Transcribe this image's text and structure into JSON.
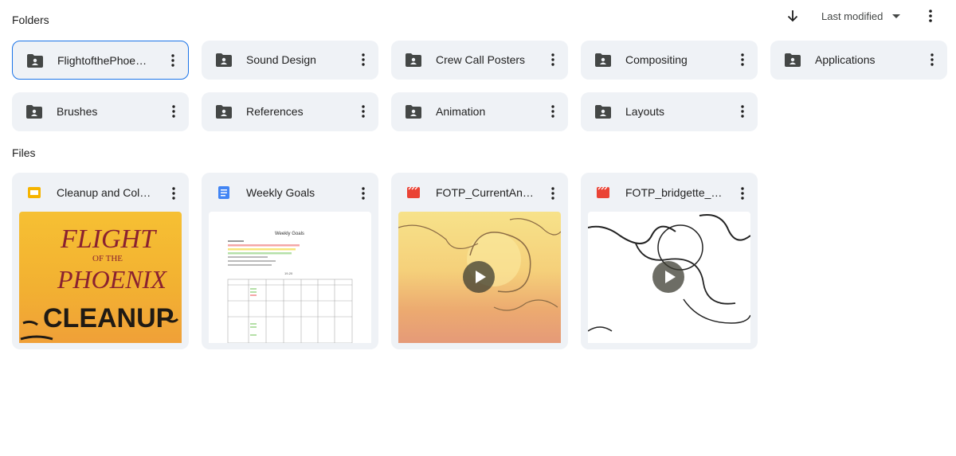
{
  "sections": {
    "folders_title": "Folders",
    "files_title": "Files"
  },
  "toolbar": {
    "sort_label": "Last modified",
    "icons": [
      "arrow-down-icon",
      "caret-down-icon",
      "more-vert-icon"
    ]
  },
  "folders": [
    {
      "name": "FlightofthePhoe…",
      "selected": true
    },
    {
      "name": "Sound Design"
    },
    {
      "name": "Crew Call Posters"
    },
    {
      "name": "Compositing"
    },
    {
      "name": "Applications"
    },
    {
      "name": "Brushes"
    },
    {
      "name": "References"
    },
    {
      "name": "Animation"
    },
    {
      "name": "Layouts"
    }
  ],
  "files": [
    {
      "name": "Cleanup and Col…",
      "type": "slides",
      "icon": "slides-icon",
      "icon_color": "#f6b400",
      "thumb": {
        "line1": "FLIGHT",
        "line2": "OF THE",
        "line3": "PHOENIX",
        "line4": "CLEANUP"
      }
    },
    {
      "name": "Weekly Goals",
      "type": "doc",
      "icon": "docs-icon",
      "icon_color": "#4285f4",
      "thumb": {
        "heading": "Weekly Goals"
      }
    },
    {
      "name": "FOTP_CurrentAn…",
      "type": "video",
      "icon": "video-icon",
      "icon_color": "#ea4335"
    },
    {
      "name": "FOTP_bridgette_…",
      "type": "video",
      "icon": "video-icon",
      "icon_color": "#ea4335"
    }
  ],
  "colors": {
    "tile_bg": "#eff2f6",
    "selected_border": "#1a73e8",
    "folder_icon": "#444746"
  }
}
